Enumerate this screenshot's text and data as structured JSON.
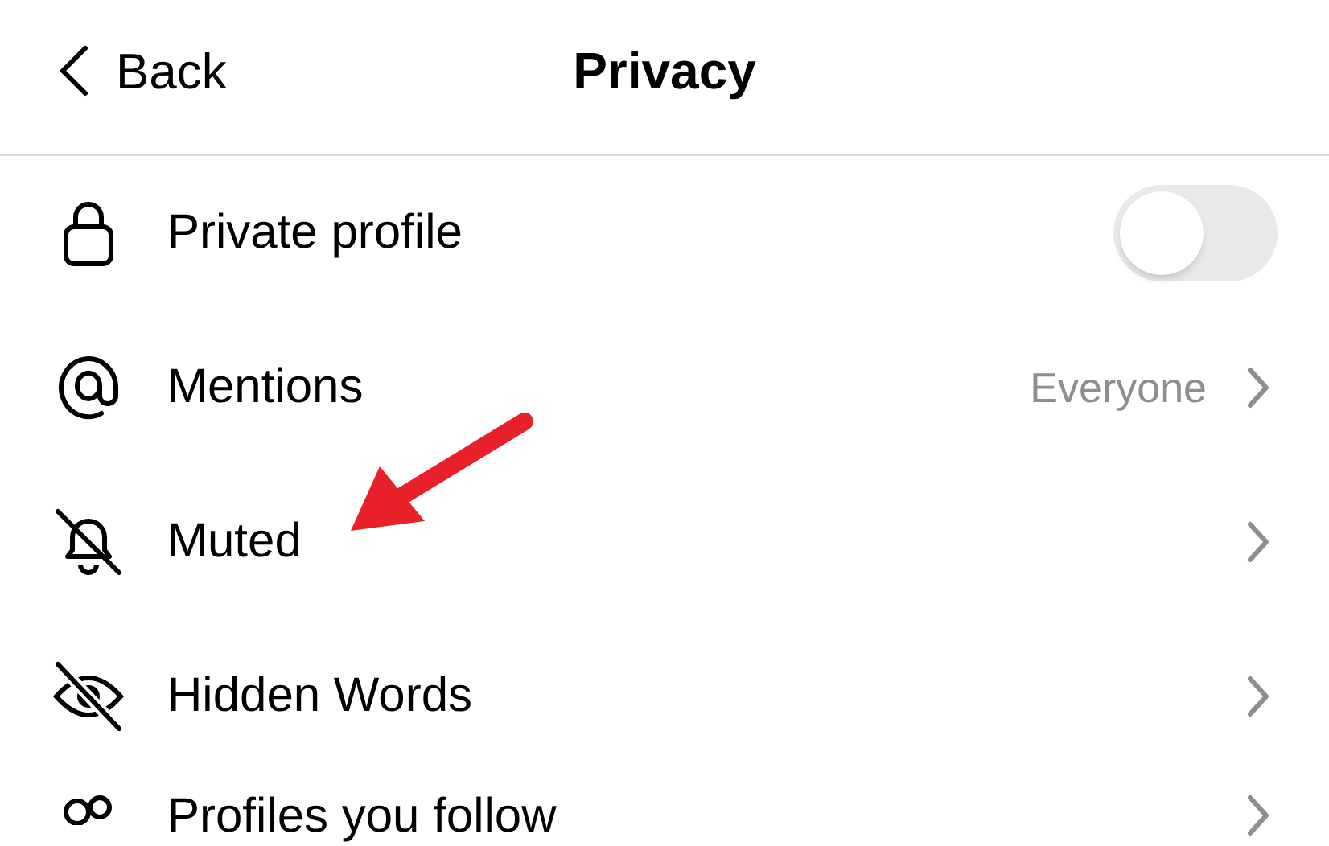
{
  "header": {
    "back": "Back",
    "title": "Privacy"
  },
  "rows": [
    {
      "kind": "toggle",
      "label": "Private profile",
      "on": false
    },
    {
      "kind": "value",
      "label": "Mentions",
      "value": "Everyone"
    },
    {
      "kind": "link",
      "label": "Muted"
    },
    {
      "kind": "link",
      "label": "Hidden Words"
    },
    {
      "kind": "link",
      "label": "Profiles you follow"
    }
  ]
}
